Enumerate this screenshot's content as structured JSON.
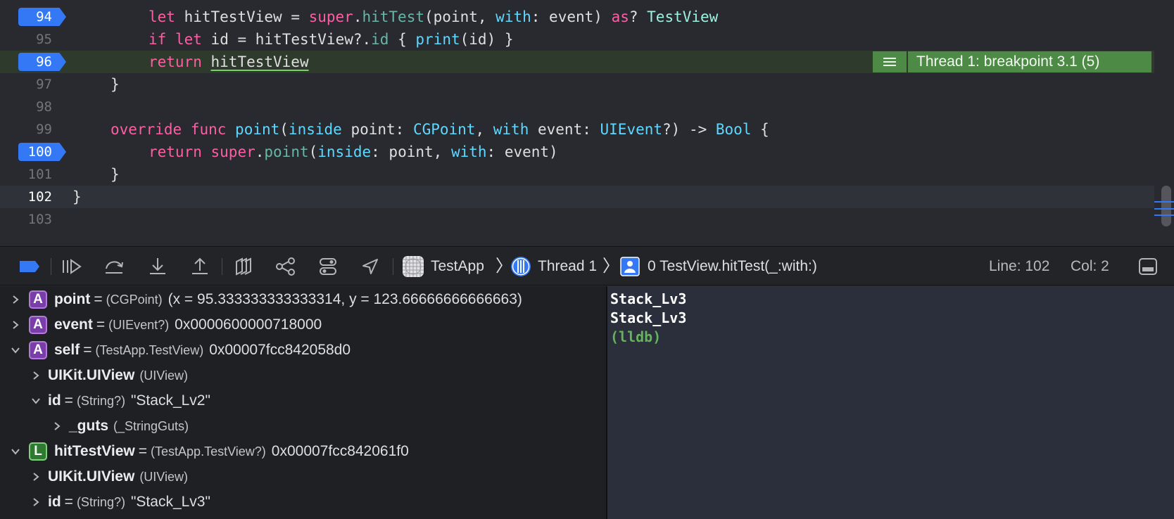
{
  "editor": {
    "lines": [
      {
        "number": "94",
        "breakpoint": true
      },
      {
        "number": "95",
        "breakpoint": false
      },
      {
        "number": "96",
        "breakpoint": true
      },
      {
        "number": "97",
        "breakpoint": false
      },
      {
        "number": "98",
        "breakpoint": false
      },
      {
        "number": "99",
        "breakpoint": false
      },
      {
        "number": "100",
        "breakpoint": true
      },
      {
        "number": "101",
        "breakpoint": false
      },
      {
        "number": "102",
        "breakpoint": false
      },
      {
        "number": "103",
        "breakpoint": false
      }
    ],
    "tokens": {
      "let": "let",
      "if": "if",
      "return": "return",
      "override": "override",
      "func": "func",
      "super": "super",
      "as": "as",
      "inside": "inside",
      "with": "with",
      "hitTestView": "hitTestView",
      "hitTest": "hitTest",
      "TestView": "TestView",
      "id": "id",
      "print": "print",
      "point": "point",
      "event": "event",
      "CGPoint": "CGPoint",
      "UIEvent": "UIEvent",
      "Bool": "Bool",
      "close_brace": "}"
    },
    "thread_badge": {
      "icon": "menu-lines-icon",
      "text": "Thread 1: breakpoint 3.1 (5)"
    },
    "colors": {
      "keyword": "#fc5fa3",
      "type": "#5dd8ff",
      "function": "#67b7a4",
      "breakpoint": "#3478f6",
      "thread_highlight": "#4d8a45"
    }
  },
  "debug_bar": {
    "tools": [
      "toggle-breakpoints-icon",
      "continue-icon",
      "step-over-icon",
      "step-into-icon",
      "step-out-icon",
      "view-hierarchy-icon",
      "memory-graph-icon",
      "environment-overrides-icon",
      "simulate-location-icon"
    ],
    "breadcrumb": {
      "app": "TestApp",
      "thread": "Thread 1",
      "frame": "0 TestView.hitTest(_:with:)"
    },
    "line_label": "Line: 102",
    "col_label": "Col: 2"
  },
  "variables": [
    {
      "indent": 0,
      "expanded": false,
      "kind": "A",
      "name": "point",
      "type": "(CGPoint)",
      "value": "(x = 95.333333333333314, y = 123.66666666666663)"
    },
    {
      "indent": 0,
      "expanded": false,
      "kind": "A",
      "name": "event",
      "type": "(UIEvent?)",
      "value": "0x0000600000718000"
    },
    {
      "indent": 0,
      "expanded": true,
      "kind": "A",
      "name": "self",
      "type": "(TestApp.TestView)",
      "value": "0x00007fcc842058d0"
    },
    {
      "indent": 1,
      "expanded": false,
      "kind": "",
      "name": "UIKit.UIView",
      "type": "(UIView)",
      "value": ""
    },
    {
      "indent": 1,
      "expanded": true,
      "kind": "",
      "name": "id",
      "type": "(String?)",
      "value": "\"Stack_Lv2\""
    },
    {
      "indent": 2,
      "expanded": false,
      "kind": "",
      "name": "_guts",
      "type": "(_StringGuts)",
      "value": ""
    },
    {
      "indent": 0,
      "expanded": true,
      "kind": "L",
      "name": "hitTestView",
      "type": "(TestApp.TestView?)",
      "value": "0x00007fcc842061f0"
    },
    {
      "indent": 1,
      "expanded": false,
      "kind": "",
      "name": "UIKit.UIView",
      "type": "(UIView)",
      "value": ""
    },
    {
      "indent": 1,
      "expanded": false,
      "kind": "",
      "name": "id",
      "type": "(String?)",
      "value": "\"Stack_Lv3\""
    }
  ],
  "console": {
    "lines": [
      "Stack_Lv3",
      "Stack_Lv3"
    ],
    "prompt": "(lldb)"
  }
}
